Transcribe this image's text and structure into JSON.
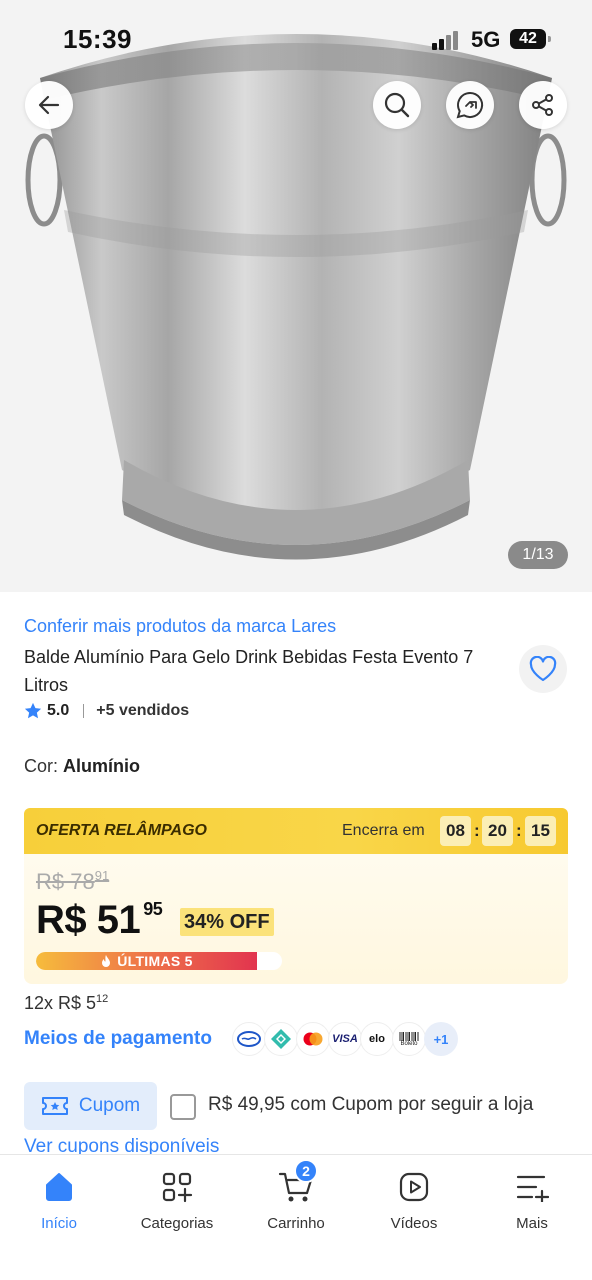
{
  "status_bar": {
    "time": "15:39",
    "network": "5G",
    "battery": "42"
  },
  "gallery": {
    "counter": "1/13"
  },
  "product": {
    "brand_link": "Conferir mais produtos da marca Lares",
    "title": "Balde Alumínio Para Gelo Drink Bebidas Festa Evento 7 Litros",
    "rating": "5.0",
    "sold": "+5 vendidos",
    "color_label": "Cor:",
    "color_value": "Alumínio"
  },
  "offer": {
    "title": "OFERTA RELÂMPAGO",
    "ends_label": "Encerra em",
    "timer": {
      "hours": "08",
      "minutes": "20",
      "seconds": "15"
    },
    "old_price_int": "R$ 78",
    "old_price_cents": "91",
    "price_int": "R$ 51",
    "price_cents": "95",
    "discount": "34% OFF",
    "stock_label": "ÚLTIMAS 5",
    "stock_fraction": 0.9
  },
  "installments": {
    "text": "12x R$ 5",
    "cents": "12"
  },
  "payment": {
    "link": "Meios de pagamento",
    "methods": [
      "mercado-pago",
      "pix",
      "mastercard",
      "VISA",
      "elo",
      "Boleto"
    ],
    "more": "+1"
  },
  "coupon": {
    "chip_label": "Cupom",
    "offer_text": "R$ 49,95 com Cupom por seguir a loja",
    "see_all": "Ver cupons disponíveis"
  },
  "nav": {
    "items": [
      {
        "label": "Início",
        "icon": "home-icon"
      },
      {
        "label": "Categorias",
        "icon": "categories-icon"
      },
      {
        "label": "Carrinho",
        "icon": "cart-icon",
        "badge": "2"
      },
      {
        "label": "Vídeos",
        "icon": "video-icon"
      },
      {
        "label": "Mais",
        "icon": "more-icon"
      }
    ]
  },
  "colors": {
    "accent": "#3483fa",
    "offer_yellow": "#f9d648"
  }
}
